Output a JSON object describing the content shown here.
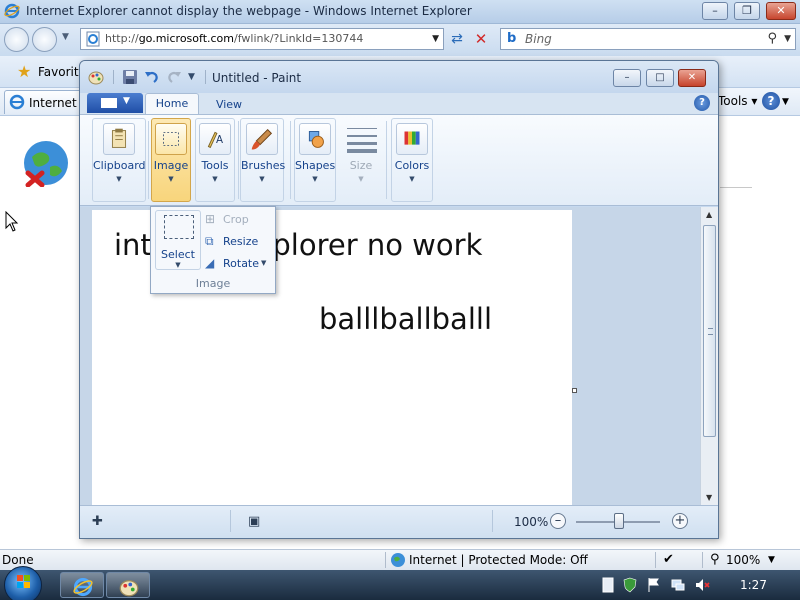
{
  "ie": {
    "window_title": "Internet Explorer cannot display the webpage - Windows Internet Explorer",
    "address_prefix": "http://",
    "address_host": "go.microsoft.com",
    "address_path": "/fwlink/?LinkId=130744",
    "search_placeholder": "Bing",
    "favorites_label": "Favorites",
    "tab_label": "Internet E",
    "tools_label": "Tools",
    "status_done": "Done",
    "status_zone": "Internet | Protected Mode: Off",
    "status_zoom": "100%"
  },
  "paint": {
    "title": "Untitled - Paint",
    "tabs": {
      "home": "Home",
      "view": "View"
    },
    "ribbon": {
      "clipboard": "Clipboard",
      "image": "Image",
      "tools": "Tools",
      "brushes": "Brushes",
      "shapes": "Shapes",
      "size": "Size",
      "colors": "Colors"
    },
    "image_menu": {
      "select": "Select",
      "crop": "Crop",
      "resize": "Resize",
      "rotate": "Rotate",
      "footer": "Image"
    },
    "canvas_text": [
      "internet explorer no work",
      "balllballballl"
    ],
    "zoom": "100%"
  },
  "taskbar": {
    "clock": "1:27"
  },
  "colors": {
    "accent": "#15428b",
    "ribbon_active": "#f8d57c",
    "close_red": "#c6432c"
  },
  "icons": [
    "ie-icon",
    "paint-icon",
    "back-icon",
    "forward-icon",
    "refresh-icon",
    "stop-icon",
    "bing-icon",
    "search-icon",
    "favorites-star-icon",
    "help-icon",
    "globe-error-icon",
    "cursor-icon",
    "save-icon",
    "undo-icon",
    "redo-icon",
    "start-orb-icon",
    "security-shield-icon",
    "flag-icon",
    "network-icon",
    "volume-mute-icon"
  ]
}
